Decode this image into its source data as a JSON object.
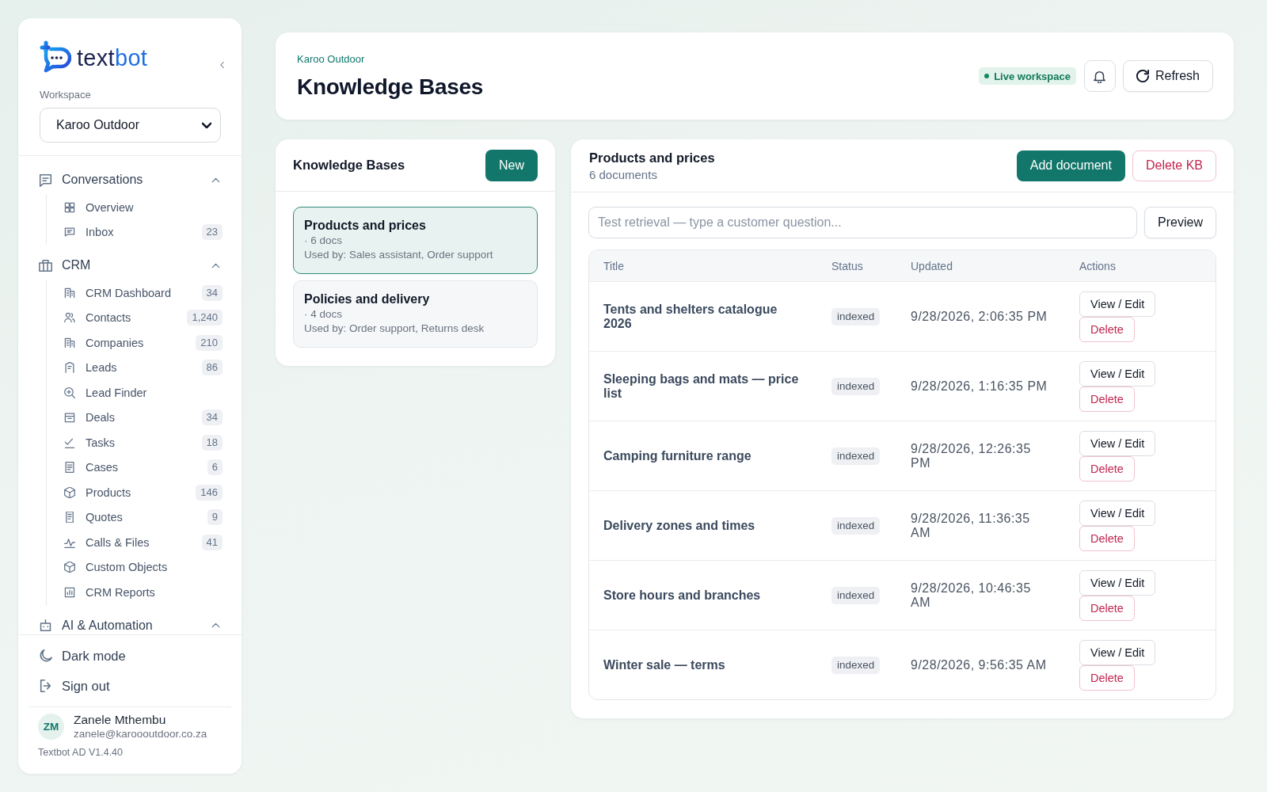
{
  "sidebar": {
    "logo": {
      "prefix": "text",
      "suffix": "bot"
    },
    "workspace": {
      "label": "Workspace",
      "value": "Karoo Outdoor"
    },
    "sections": [
      {
        "label": "Conversations",
        "expanded": true,
        "items": [
          {
            "label": "Overview"
          },
          {
            "label": "Inbox",
            "count": "23"
          }
        ]
      },
      {
        "label": "CRM",
        "expanded": true,
        "items": [
          {
            "label": "CRM Dashboard",
            "count": "34"
          },
          {
            "label": "Contacts",
            "count": "1,240"
          },
          {
            "label": "Companies",
            "count": "210"
          },
          {
            "label": "Leads",
            "count": "86"
          },
          {
            "label": "Lead Finder"
          },
          {
            "label": "Deals",
            "count": "34"
          },
          {
            "label": "Tasks",
            "count": "18"
          },
          {
            "label": "Cases",
            "count": "6"
          },
          {
            "label": "Products",
            "count": "146"
          },
          {
            "label": "Quotes",
            "count": "9"
          },
          {
            "label": "Calls & Files",
            "count": "41"
          },
          {
            "label": "Custom Objects"
          },
          {
            "label": "CRM Reports"
          }
        ]
      },
      {
        "label": "AI & Automation",
        "expanded": true
      }
    ],
    "footer": {
      "actions": [
        {
          "label": "Dark mode"
        },
        {
          "label": "Sign out"
        }
      ],
      "user": {
        "initials": "ZM",
        "name": "Zanele Mthembu",
        "email": "zanele@karoooutdoor.co.za"
      },
      "version": "Textbot AD V1.4.40"
    }
  },
  "header": {
    "breadcrumb": "Karoo Outdoor",
    "title": "Knowledge Bases",
    "status": "Live workspace",
    "refresh_button": "Refresh"
  },
  "kb_list": {
    "title": "Knowledge Bases",
    "new_button": "New",
    "items": [
      {
        "name": "Products and prices",
        "docs": "· 6 docs",
        "used_by": "Used by: Sales assistant, Order support",
        "selected": true
      },
      {
        "name": "Policies and delivery",
        "docs": "· 4 docs",
        "used_by": "Used by: Order support, Returns desk",
        "selected": false
      }
    ]
  },
  "detail": {
    "title": "Products and prices",
    "subtitle": "6 documents",
    "add_button": "Add document",
    "delete_button": "Delete KB",
    "search": {
      "placeholder": "Test retrieval — type a customer question..."
    },
    "preview_button": "Preview",
    "table": {
      "columns": [
        "Title",
        "Status",
        "Updated",
        "Actions"
      ],
      "rows": [
        {
          "title": "Tents and shelters catalogue 2026",
          "status": "indexed",
          "updated": "9/28/2026, 2:06:35 PM",
          "edit_button": "View / Edit",
          "delete_button": "Delete"
        },
        {
          "title": "Sleeping bags and mats — price list",
          "status": "indexed",
          "updated": "9/28/2026, 1:16:35 PM",
          "edit_button": "View / Edit",
          "delete_button": "Delete"
        },
        {
          "title": "Camping furniture range",
          "status": "indexed",
          "updated": "9/28/2026, 12:26:35 PM",
          "edit_button": "View / Edit",
          "delete_button": "Delete"
        },
        {
          "title": "Delivery zones and times",
          "status": "indexed",
          "updated": "9/28/2026, 11:36:35 AM",
          "edit_button": "View / Edit",
          "delete_button": "Delete"
        },
        {
          "title": "Store hours and branches",
          "status": "indexed",
          "updated": "9/28/2026, 10:46:35 AM",
          "edit_button": "View / Edit",
          "delete_button": "Delete"
        },
        {
          "title": "Winter sale — terms",
          "status": "indexed",
          "updated": "9/28/2026, 9:56:35 AM",
          "edit_button": "View / Edit",
          "delete_button": "Delete"
        }
      ]
    }
  }
}
